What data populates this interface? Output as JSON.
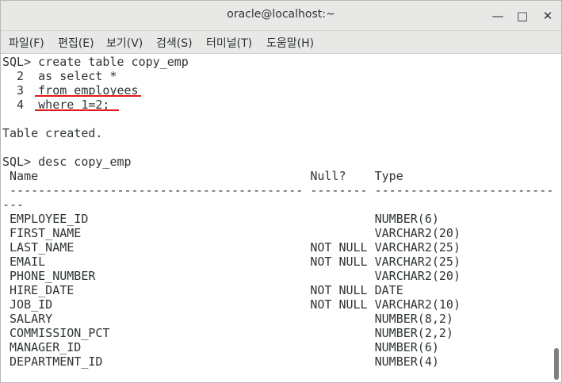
{
  "window": {
    "title": "oracle@localhost:~",
    "minimize_icon": "—",
    "maximize_icon": "□",
    "close_icon": "✕"
  },
  "menu": {
    "items": [
      {
        "label": "파일(F)"
      },
      {
        "label": "편집(E)"
      },
      {
        "label": "보기(V)"
      },
      {
        "label": "검색(S)"
      },
      {
        "label": "터미널(T)"
      },
      {
        "label": "도움말(H)"
      }
    ]
  },
  "terminal": {
    "lines": [
      "SQL> create table copy_emp",
      "  2  as select *",
      "  3  from employees",
      "  4  where 1=2;",
      "",
      "Table created.",
      "",
      "SQL> desc copy_emp",
      " Name                                      Null?    Type",
      " ----------------------------------------- -------- ----------------------------",
      "",
      " EMPLOYEE_ID                                        NUMBER(6)",
      " FIRST_NAME                                         VARCHAR2(20)",
      " LAST_NAME                                 NOT NULL VARCHAR2(25)",
      " EMAIL                                     NOT NULL VARCHAR2(25)",
      " PHONE_NUMBER                                       VARCHAR2(20)",
      " HIRE_DATE                                 NOT NULL DATE",
      " JOB_ID                                    NOT NULL VARCHAR2(10)",
      " SALARY                                             NUMBER(8,2)",
      " COMMISSION_PCT                                     NUMBER(2,2)",
      " MANAGER_ID                                         NUMBER(6)",
      " DEPARTMENT_ID                                      NUMBER(4)"
    ],
    "dash_wrap": "---"
  },
  "annotations": {
    "underline_color": "#e31919"
  }
}
